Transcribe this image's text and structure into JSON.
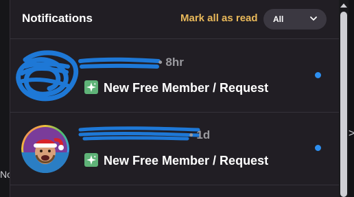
{
  "header": {
    "title": "Notifications",
    "mark_all_read_label": "Mark all as read",
    "filter_selected": "All"
  },
  "notifications": [
    {
      "name_partial": "",
      "time": "8hr",
      "message": "New Free Member / Request",
      "unread": true,
      "avatar": "redacted"
    },
    {
      "name_partial": "",
      "time": "1d",
      "message": "New Free Member / Request",
      "unread": true,
      "avatar": "santa-hat-user"
    }
  ],
  "background": {
    "left_text": "No",
    "right_glyph": ">"
  },
  "colors": {
    "panel": "#211e24",
    "accent_link": "#e8b85a",
    "unread_dot": "#2d8ff0",
    "spark_icon": "#5fb378",
    "redaction": "#1e78d6"
  }
}
